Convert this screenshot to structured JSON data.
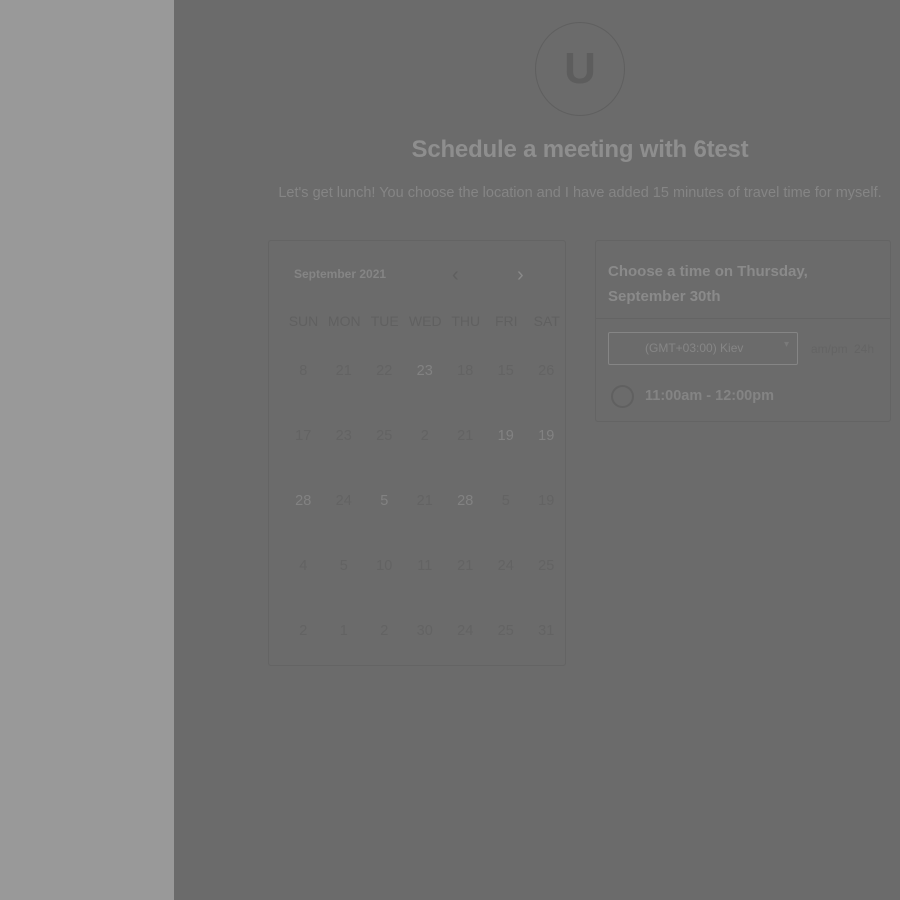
{
  "avatar": {
    "initial": "U"
  },
  "header": {
    "title": "Schedule a meeting with 6test",
    "subtitle": "Let's get lunch! You choose the location and I have added 15 minutes of travel time for myself."
  },
  "calendar": {
    "month_label": "September 2021",
    "prev_icon": "chevron-left-icon",
    "next_icon": "chevron-right-icon",
    "weekdays": [
      "SUN",
      "MON",
      "TUE",
      "WED",
      "THU",
      "FRI",
      "SAT"
    ],
    "weeks": [
      [
        "8",
        "21",
        "22",
        "23",
        "18",
        "15",
        "26"
      ],
      [
        "17",
        "23",
        "25",
        "2",
        "21",
        "19",
        "19"
      ],
      [
        "28",
        "24",
        "5",
        "21",
        "28",
        "5",
        "19"
      ],
      [
        "4",
        "5",
        "10",
        "11",
        "21",
        "24",
        "25"
      ],
      [
        "2",
        "1",
        "2",
        "30",
        "24",
        "25",
        "31"
      ]
    ]
  },
  "times": {
    "title": "Choose a time on Thursday, September 30th",
    "timezone": "(GMT+03:00) Kiev",
    "format_ampm": "am/pm",
    "format_24": "24h",
    "slots": [
      "11:00am - 12:00pm"
    ]
  }
}
